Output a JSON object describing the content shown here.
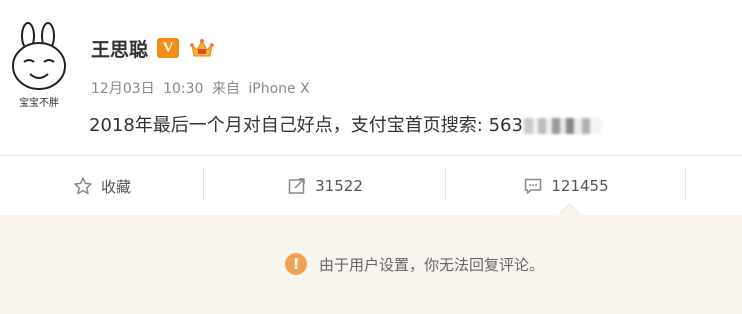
{
  "post": {
    "avatar_caption": "宝宝不胖",
    "username": "王思聪",
    "verified_badge": "V",
    "date": "12月03日",
    "time": "10:30",
    "source_prefix": "来自",
    "source_device": "iPhone X",
    "text": "2018年最后一个月对自己好点，支付宝首页搜索: 563"
  },
  "actions": {
    "favorite_label": "收藏",
    "repost_count": "31522",
    "comment_count": "121455"
  },
  "comments": {
    "notice": "由于用户设置，你无法回复评论。"
  },
  "colors": {
    "badge_orange": "#f28d17",
    "warning_orange": "#f0a254",
    "panel_bg": "#faf4ef"
  }
}
